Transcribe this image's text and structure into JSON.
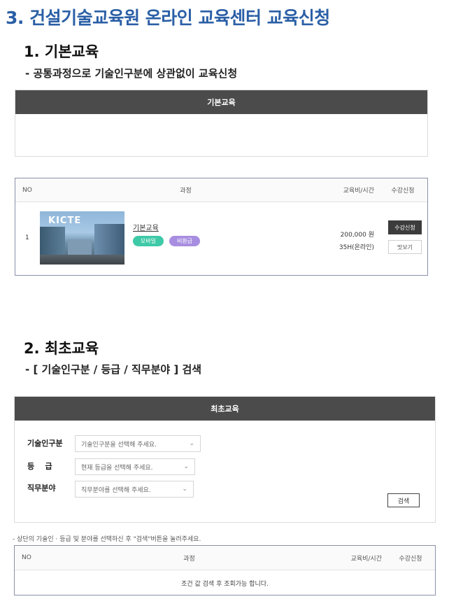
{
  "page": {
    "main_heading": "3. 건설기술교육원 온라인 교육센터 교육신청"
  },
  "basic": {
    "heading": "1. 기본교육",
    "subheading": "- 공통과정으로 기술인구분에 상관없이 교육신청",
    "panel_title": "기본교육",
    "table": {
      "headers": {
        "no": "NO",
        "course": "과정",
        "fee": "교육비/시간",
        "apply": "수강신청"
      },
      "rows": [
        {
          "no": "1",
          "thumb_brand": "KICTE",
          "title": "기본교육",
          "badges": [
            "모바일",
            "비환급"
          ],
          "price": "200,000 원",
          "hours": "35H(온라인)",
          "apply_label": "수강신청",
          "preview_label": "맛보기"
        }
      ]
    }
  },
  "initial": {
    "heading": "2. 최초교육",
    "subheading": "- [ 기술인구분 / 등급 / 직무분야 ]  검색",
    "panel_title": "최초교육",
    "filters": [
      {
        "label": "기술인구분",
        "placeholder": "기술인구분을 선택해 주세요."
      },
      {
        "label": "등    급",
        "placeholder": "현재 등급을 선택해 주세요."
      },
      {
        "label": "직무분야",
        "placeholder": "직무분야를 선택해 주세요."
      }
    ],
    "search_label": "검색",
    "notice": "- 상단의 기술인 · 등급 및 분야를 선택하신 후 \"검색\"버튼을 눌러주세요.",
    "table": {
      "headers": {
        "no": "NO",
        "course": "과정",
        "fee": "교육비/시간",
        "apply": "수강신청"
      },
      "empty_message": "조건 값 검색 후 조회가능 합니다."
    }
  },
  "colors": {
    "heading_blue": "#2b5fa6",
    "panel_bar": "#4b4b4b",
    "badge_mobile": "#3ec9a7",
    "badge_free": "#a88ee0",
    "apply_button": "#3c3c3c"
  }
}
